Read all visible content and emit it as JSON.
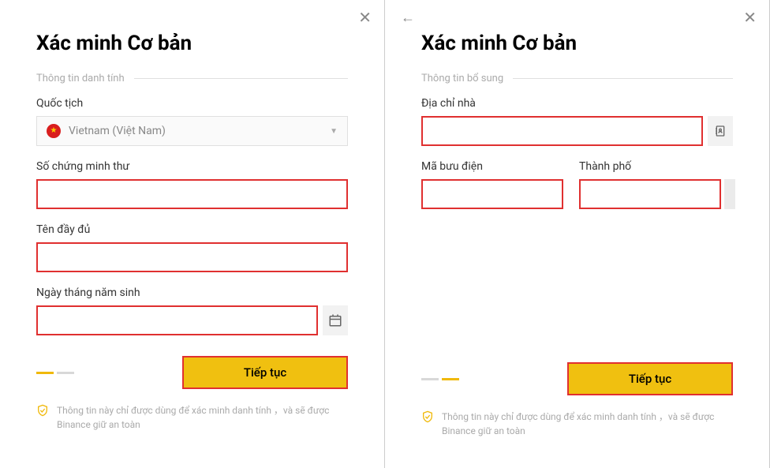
{
  "panel1": {
    "title": "Xác minh Cơ bản",
    "section": "Thông tin danh tính",
    "nationality_label": "Quốc tịch",
    "nationality_value": "Vietnam (Việt Nam)",
    "id_label": "Số chứng minh thư",
    "fullname_label": "Tên đầy đủ",
    "dob_label": "Ngày tháng năm sinh",
    "continue": "Tiếp tục",
    "footer": "Thông tin này chỉ được dùng để xác minh danh tính ，và sẽ được Binance giữ an toàn",
    "progress_step": 1
  },
  "panel2": {
    "title": "Xác minh Cơ bản",
    "section": "Thông tin bổ sung",
    "address_label": "Địa chỉ nhà",
    "postal_label": "Mã bưu điện",
    "city_label": "Thành phố",
    "continue": "Tiếp tục",
    "footer": "Thông tin này chỉ được dùng để xác minh danh tính ，và sẽ được Binance giữ an toàn",
    "progress_step": 2
  }
}
